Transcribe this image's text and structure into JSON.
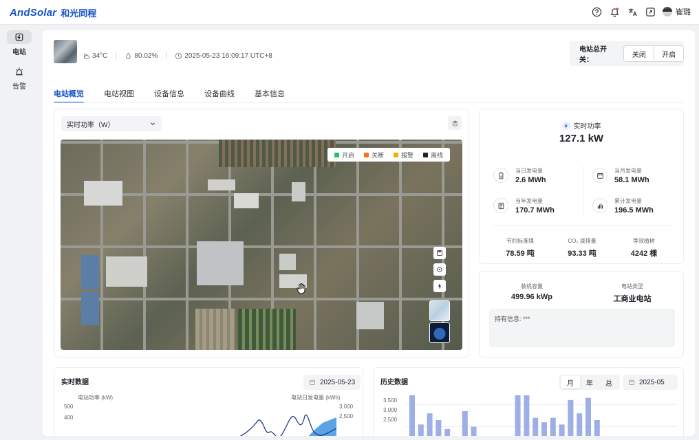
{
  "header": {
    "logo_en": "AndSolar",
    "logo_cn": "和光同程",
    "user_name": "崔璐"
  },
  "sidenav": {
    "items": [
      {
        "label": "电站",
        "icon": "power-station-icon",
        "active": true
      },
      {
        "label": "告警",
        "icon": "alarm-icon",
        "active": false
      }
    ]
  },
  "station": {
    "weather": "34°C",
    "humidity": "80.02%",
    "datetime": "2025-05-23 16:09:17 UTC+8",
    "switch_label": "电站总开关：",
    "switch_off": "关闭",
    "switch_on": "开启"
  },
  "tabs": [
    {
      "label": "电站概览",
      "active": true
    },
    {
      "label": "电站视图",
      "active": false
    },
    {
      "label": "设备信息",
      "active": false
    },
    {
      "label": "设备曲线",
      "active": false
    },
    {
      "label": "基本信息",
      "active": false
    }
  ],
  "map_panel": {
    "select_value": "实时功率（W）",
    "legend": [
      {
        "label": "开启",
        "color": "#22c55e"
      },
      {
        "label": "关断",
        "color": "#f97316"
      },
      {
        "label": "报警",
        "color": "#eab308"
      },
      {
        "label": "离线",
        "color": "#222222"
      }
    ]
  },
  "power": {
    "title": "实时功率",
    "value": "127.1 kW",
    "stats": [
      {
        "label": "当日发电量",
        "value": "2.6 MWh",
        "icon": "battery-icon"
      },
      {
        "label": "当月发电量",
        "value": "58.1 MWh",
        "icon": "calendar-icon"
      },
      {
        "label": "当年发电量",
        "value": "170.7 MWh",
        "icon": "document-icon"
      },
      {
        "label": "累计发电量",
        "value": "196.5 MWh",
        "icon": "bar-chart-icon"
      }
    ],
    "eco": [
      {
        "label": "节约标准煤",
        "value": "78.59 吨"
      },
      {
        "label": "CO₂ 减排量",
        "value": "93.33 吨"
      },
      {
        "label": "等效植树",
        "value": "4242 棵"
      }
    ]
  },
  "info": {
    "capacity_label": "装机容量",
    "capacity_value": "499.96 kWp",
    "type_label": "电站类型",
    "type_value": "工商业电站",
    "holder": "持有信息: ***"
  },
  "realtime": {
    "title": "实时数据",
    "date": "2025-05-23",
    "left_axis_label": "电站功率 (kW)",
    "right_axis_label": "电站日发电量 (kWh)",
    "left_ticks": [
      "500",
      "400"
    ],
    "right_ticks": [
      "3,000",
      "2,500"
    ]
  },
  "history": {
    "title": "历史数据",
    "segments": [
      {
        "label": "月",
        "active": true
      },
      {
        "label": "年",
        "active": false
      },
      {
        "label": "总",
        "active": false
      }
    ],
    "date": "2025-05",
    "y_ticks": [
      "3,500",
      "3,000",
      "2,500"
    ]
  },
  "chart_data": {
    "type": "bar",
    "ylim": [
      2000,
      3700
    ],
    "values": [
      3250,
      2550,
      2800,
      2650,
      2450,
      0,
      2850,
      2500,
      0,
      0,
      0,
      0,
      3300,
      3350,
      2700,
      2600,
      2700,
      2550,
      3100,
      2800,
      3150,
      2650,
      0,
      0,
      0,
      0,
      0,
      0,
      0,
      0,
      0
    ]
  }
}
